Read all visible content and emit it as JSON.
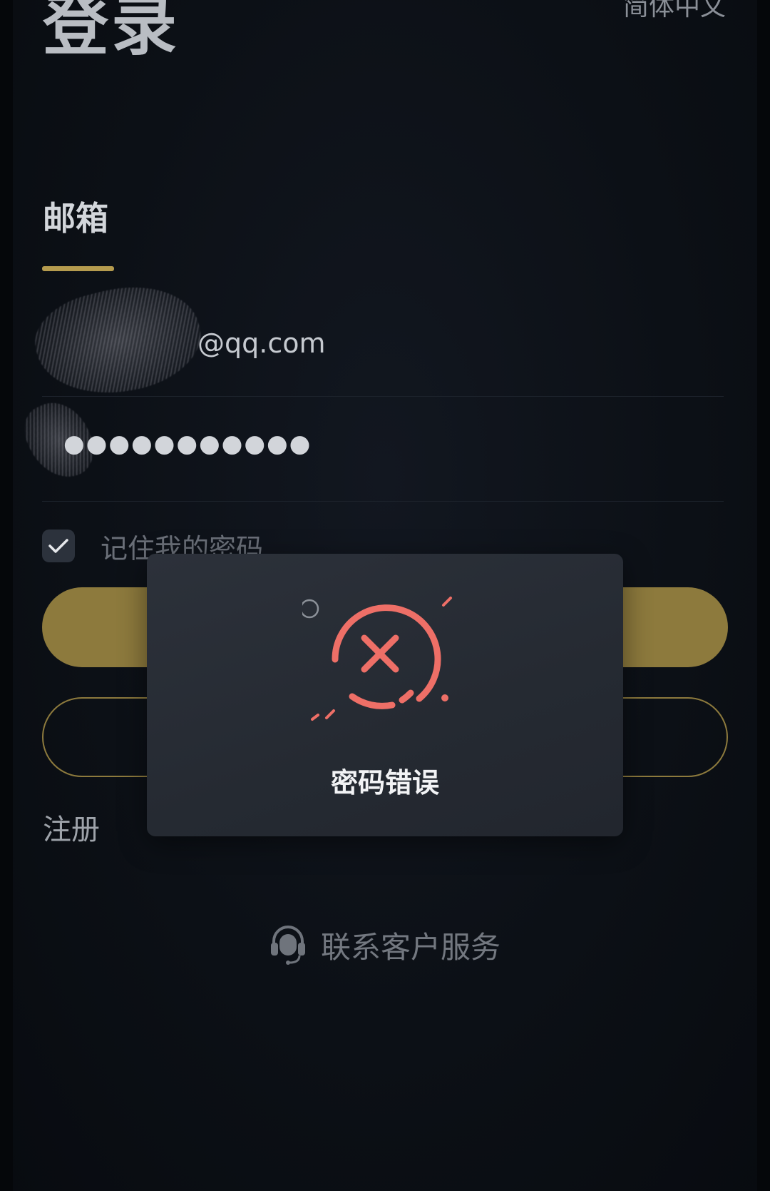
{
  "header": {
    "title": "登录",
    "language": "简体中文"
  },
  "login_tabs": {
    "email_tab": "邮箱"
  },
  "form": {
    "email_value": "@qq.com",
    "password_value": "●●●●●●●●●●●",
    "remember_label": "记住我的密码",
    "remember_checked": true
  },
  "links": {
    "register": "注册",
    "support": "联系客户服务"
  },
  "dialog": {
    "message": "密码错误",
    "icon": "error-x-icon"
  },
  "colors": {
    "accent_gold": "#b59b4e",
    "button_gold": "#8d7a3d",
    "error_red": "#ee6f67",
    "background": "#0b0f15"
  }
}
